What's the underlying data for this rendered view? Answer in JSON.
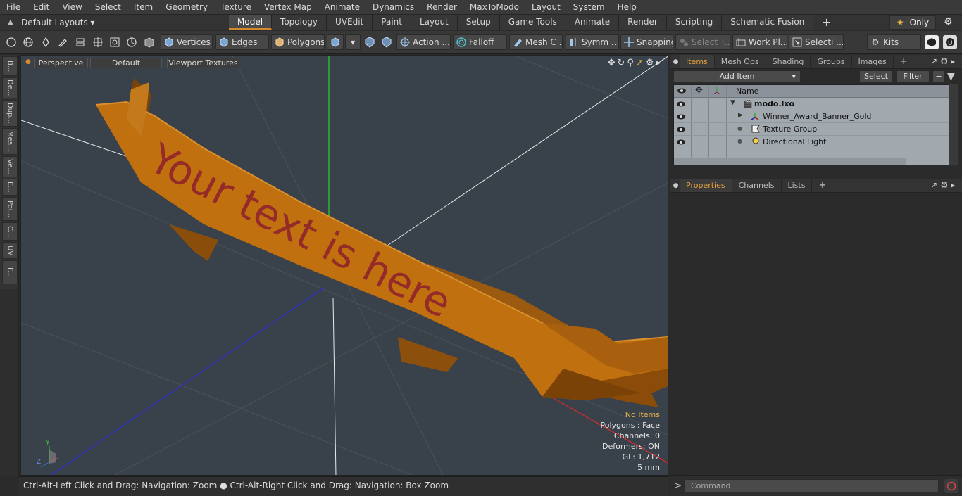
{
  "menu": [
    "File",
    "Edit",
    "View",
    "Select",
    "Item",
    "Geometry",
    "Texture",
    "Vertex Map",
    "Animate",
    "Dynamics",
    "Render",
    "MaxToModo",
    "Layout",
    "System",
    "Help"
  ],
  "layout_selector": "Default Layouts",
  "layout_tabs": [
    "Model",
    "Topology",
    "UVEdit",
    "Paint",
    "Layout",
    "Setup",
    "Game Tools",
    "Animate",
    "Render",
    "Scripting",
    "Schematic Fusion"
  ],
  "active_layout_tab": "Model",
  "only_label": "Only",
  "toolbar": {
    "vertices": "Vertices",
    "edges": "Edges",
    "polygons": "Polygons",
    "action": "Action ...",
    "falloff": "Falloff",
    "mesh": "Mesh C ...",
    "symm": "Symm ...",
    "snapping": "Snapping",
    "select_t": "Select T...",
    "workplane": "Work Pl...",
    "selection": "Selecti ...",
    "kits": "Kits"
  },
  "left_tabs": [
    "B...",
    "De...",
    "Dup...",
    "Mes...",
    "Ve...",
    "E...",
    "Pol...",
    "C...",
    "UV",
    "F..."
  ],
  "viewport": {
    "view_mode": "Perspective",
    "shading": "Default",
    "textures": "Viewport Textures",
    "banner_text": "Your text is here",
    "info": {
      "items": "No Items",
      "polygons": "Polygons : Face",
      "channels": "Channels: 0",
      "deformers": "Deformers: ON",
      "gl": "GL: 1,712",
      "grid": "5 mm"
    },
    "axis": {
      "y": "Y",
      "z": "Z"
    }
  },
  "status": {
    "hint1": "Ctrl-Alt-Left Click and Drag: Navigation: Zoom",
    "hint2": "Ctrl-Alt-Right Click and Drag: Navigation: Box Zoom"
  },
  "items_panel": {
    "tabs": [
      "Items",
      "Mesh Ops",
      "Shading",
      "Groups",
      "Images"
    ],
    "active_tab": "Items",
    "add_item": "Add Item",
    "select": "Select",
    "filter": "Filter",
    "name_header": "Name",
    "tree": [
      {
        "label": "modo.lxo",
        "bold": true
      },
      {
        "label": "Winner_Award_Banner_Gold",
        "bold": false
      },
      {
        "label": "Texture Group",
        "bold": false
      },
      {
        "label": "Directional Light",
        "bold": false
      }
    ]
  },
  "properties_panel": {
    "tabs": [
      "Properties",
      "Channels",
      "Lists"
    ],
    "active_tab": "Properties"
  },
  "command": {
    "placeholder": "Command"
  },
  "colors": {
    "accent": "#e9a23b",
    "banner": "#c1700f",
    "banner_text": "#8d1f2e",
    "viewport_bg": "#39414a"
  }
}
